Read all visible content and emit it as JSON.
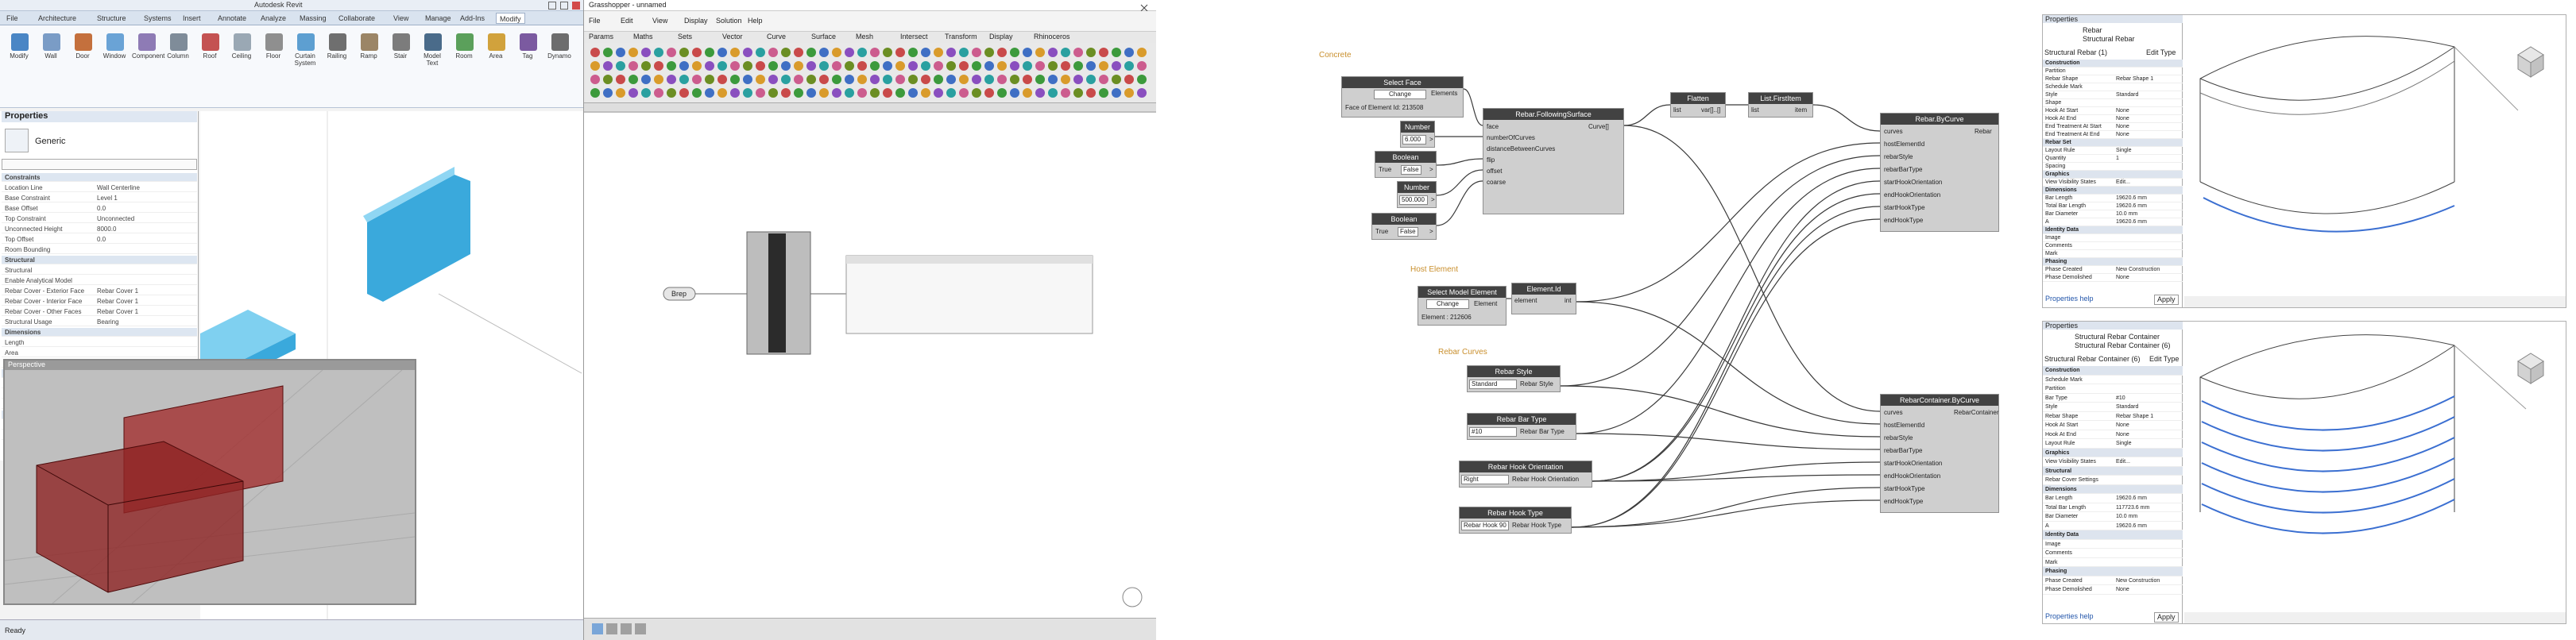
{
  "revit": {
    "title": "Autodesk Revit",
    "tabs": [
      "File",
      "Architecture",
      "Structure",
      "Systems",
      "Insert",
      "Annotate",
      "Analyze",
      "Massing",
      "Collaborate",
      "View",
      "Manage",
      "Add-Ins",
      "Modify"
    ],
    "ribbon_buttons": [
      {
        "label": "Modify",
        "color": "#4a86c5"
      },
      {
        "label": "Wall",
        "color": "#7a9cc6"
      },
      {
        "label": "Door",
        "color": "#c4703d"
      },
      {
        "label": "Window",
        "color": "#6aa3d6"
      },
      {
        "label": "Component",
        "color": "#8e7bb5"
      },
      {
        "label": "Column",
        "color": "#7f8c99"
      },
      {
        "label": "Roof",
        "color": "#c45252"
      },
      {
        "label": "Ceiling",
        "color": "#9aa8b4"
      },
      {
        "label": "Floor",
        "color": "#8f8f8f"
      },
      {
        "label": "Curtain System",
        "color": "#5d9fd1"
      },
      {
        "label": "Railing",
        "color": "#6f6f6f"
      },
      {
        "label": "Ramp",
        "color": "#9b8566"
      },
      {
        "label": "Stair",
        "color": "#7c7c7c"
      },
      {
        "label": "Model Text",
        "color": "#4a6b8a"
      },
      {
        "label": "Room",
        "color": "#5ba05b"
      },
      {
        "label": "Area",
        "color": "#d1a23c"
      },
      {
        "label": "Tag",
        "color": "#7b5aa0"
      },
      {
        "label": "Dynamo",
        "color": "#6d6d6d"
      }
    ],
    "properties_title": "Properties",
    "type_name": "Generic",
    "prop_rows": [
      {
        "k": "Constraints",
        "v": "",
        "head": true
      },
      {
        "k": "Location Line",
        "v": "Wall Centerline"
      },
      {
        "k": "Base Constraint",
        "v": "Level 1"
      },
      {
        "k": "Base Offset",
        "v": "0.0"
      },
      {
        "k": "Top Constraint",
        "v": "Unconnected"
      },
      {
        "k": "Unconnected Height",
        "v": "8000.0"
      },
      {
        "k": "Top Offset",
        "v": "0.0"
      },
      {
        "k": "Room Bounding",
        "v": ""
      },
      {
        "k": "Structural",
        "v": "",
        "head": true
      },
      {
        "k": "Structural",
        "v": ""
      },
      {
        "k": "Enable Analytical Model",
        "v": ""
      },
      {
        "k": "Rebar Cover - Exterior Face",
        "v": "Rebar Cover 1"
      },
      {
        "k": "Rebar Cover - Interior Face",
        "v": "Rebar Cover 1"
      },
      {
        "k": "Rebar Cover - Other Faces",
        "v": "Rebar Cover 1"
      },
      {
        "k": "Structural Usage",
        "v": "Bearing"
      },
      {
        "k": "Dimensions",
        "v": "",
        "head": true
      },
      {
        "k": "Length",
        "v": ""
      },
      {
        "k": "Area",
        "v": ""
      },
      {
        "k": "Volume",
        "v": ""
      },
      {
        "k": "Identity Data",
        "v": "",
        "head": true
      },
      {
        "k": "Image",
        "v": ""
      },
      {
        "k": "Comments",
        "v": ""
      },
      {
        "k": "Mark",
        "v": ""
      },
      {
        "k": "Phasing",
        "v": "",
        "head": true
      },
      {
        "k": "Phase Created",
        "v": "New Construction"
      },
      {
        "k": "Phase Demolished",
        "v": "None"
      }
    ],
    "status_text": "Ready"
  },
  "grasshopper": {
    "title": "Grasshopper - unnamed",
    "menu": [
      "File",
      "Edit",
      "View",
      "Display",
      "Solution",
      "Help"
    ],
    "tabs": [
      "Params",
      "Maths",
      "Sets",
      "Vector",
      "Curve",
      "Surface",
      "Mesh",
      "Intersect",
      "Transform",
      "Display",
      "Rhinoceros"
    ],
    "button_node_label": "Brep",
    "toggle_labels": [
      "B",
      "S",
      "E"
    ],
    "panel_label": "",
    "status_text": "",
    "tool_colors": [
      "#c94a4a",
      "#3c9a3c",
      "#3f6fc4",
      "#d99b2b",
      "#8a4fbf",
      "#2aa0a0",
      "#cc5c8e",
      "#6b8e23"
    ]
  },
  "dynamo": {
    "groups": [
      "Concrete",
      "Host Element",
      "Rebar Curves"
    ],
    "nodes": {
      "select_face": {
        "title": "Select Face",
        "button": "Change",
        "info": "Face of Element Id: 213508",
        "out": "Elements"
      },
      "number1": {
        "title": "Number",
        "value": "6.000",
        "out": ">"
      },
      "boolean1": {
        "title": "Boolean",
        "t": "True",
        "f": "False",
        "out": ">"
      },
      "number2": {
        "title": "Number",
        "value": "500.000",
        "out": ">"
      },
      "boolean2": {
        "title": "Boolean",
        "t": "True",
        "f": "False",
        "out": ">"
      },
      "rebar_follow": {
        "title": "Rebar.FollowingSurface",
        "inputs": [
          "face",
          "numberOfCurves",
          "distanceBetweenCurves",
          "flip",
          "offset",
          "coarse"
        ],
        "out": "Curve[]"
      },
      "flatten": {
        "title": "Flatten",
        "in": "list",
        "out": "var[]..[]"
      },
      "list_first": {
        "title": "List.FirstItem",
        "in": "list",
        "out": "item"
      },
      "rebar_by_curve": {
        "title": "Rebar.ByCurve",
        "inputs": [
          "curves",
          "hostElementId",
          "rebarStyle",
          "rebarBarType",
          "startHookOrientation",
          "endHookOrientation",
          "startHookType",
          "endHookType"
        ],
        "out": "Rebar"
      },
      "select_model": {
        "title": "Select Model Element",
        "button": "Change",
        "info": "Element : 212606",
        "out": "Element"
      },
      "element_id": {
        "title": "Element.Id",
        "in": "element",
        "out": "int"
      },
      "rebar_style": {
        "title": "Rebar Style",
        "value": "Standard",
        "out": "Rebar Style"
      },
      "rebar_bar_type": {
        "title": "Rebar Bar Type",
        "value": "#10",
        "out": "Rebar Bar Type"
      },
      "hook_orient": {
        "title": "Rebar Hook Orientation",
        "value": "Right",
        "out": "Rebar Hook Orientation"
      },
      "hook_type": {
        "title": "Rebar Hook Type",
        "value": "Rebar Hook 90",
        "out": "Rebar Hook Type"
      },
      "container": {
        "title": "RebarContainer.ByCurve",
        "inputs": [
          "curves",
          "hostElementId",
          "rebarStyle",
          "rebarBarType",
          "startHookOrientation",
          "endHookOrientation",
          "startHookType",
          "endHookType"
        ],
        "out": "RebarContainer"
      }
    }
  },
  "revit_result_top": {
    "title": "Properties",
    "type": "Rebar",
    "type_sub": "Structural Rebar",
    "instance": "Structural Rebar (1)",
    "edit_type": "Edit Type",
    "rows": [
      {
        "k": "Construction",
        "v": "",
        "head": true
      },
      {
        "k": "Partition",
        "v": ""
      },
      {
        "k": "Rebar Shape",
        "v": "Rebar Shape 1"
      },
      {
        "k": "Schedule Mark",
        "v": ""
      },
      {
        "k": "Style",
        "v": "Standard"
      },
      {
        "k": "Shape",
        "v": ""
      },
      {
        "k": "Hook At Start",
        "v": "None"
      },
      {
        "k": "Hook At End",
        "v": "None"
      },
      {
        "k": "End Treatment At Start",
        "v": "None"
      },
      {
        "k": "End Treatment At End",
        "v": "None"
      },
      {
        "k": "Rebar Set",
        "v": "",
        "head": true
      },
      {
        "k": "Layout Rule",
        "v": "Single"
      },
      {
        "k": "Quantity",
        "v": "1"
      },
      {
        "k": "Spacing",
        "v": ""
      },
      {
        "k": "Graphics",
        "v": "",
        "head": true
      },
      {
        "k": "View Visibility States",
        "v": "Edit..."
      },
      {
        "k": "Dimensions",
        "v": "",
        "head": true
      },
      {
        "k": "Bar Length",
        "v": "19620.6 mm"
      },
      {
        "k": "Total Bar Length",
        "v": "19620.6 mm"
      },
      {
        "k": "Bar Diameter",
        "v": "10.0 mm"
      },
      {
        "k": "A",
        "v": "19620.6 mm"
      },
      {
        "k": "Identity Data",
        "v": "",
        "head": true
      },
      {
        "k": "Image",
        "v": ""
      },
      {
        "k": "Comments",
        "v": ""
      },
      {
        "k": "Mark",
        "v": ""
      },
      {
        "k": "Phasing",
        "v": "",
        "head": true
      },
      {
        "k": "Phase Created",
        "v": "New Construction"
      },
      {
        "k": "Phase Demolished",
        "v": "None"
      }
    ],
    "help_link": "Properties help",
    "apply": "Apply"
  },
  "revit_result_bottom": {
    "title": "Properties",
    "type": "Structural Rebar Container",
    "type_sub": "Structural Rebar Container (6)",
    "instance": "Structural Rebar Container (6)",
    "edit_type": "Edit Type",
    "rows": [
      {
        "k": "Construction",
        "v": "",
        "head": true
      },
      {
        "k": "Schedule Mark",
        "v": ""
      },
      {
        "k": "Partition",
        "v": ""
      },
      {
        "k": "Bar Type",
        "v": "#10"
      },
      {
        "k": "Style",
        "v": "Standard"
      },
      {
        "k": "Rebar Shape",
        "v": "Rebar Shape 1"
      },
      {
        "k": "Hook At Start",
        "v": "None"
      },
      {
        "k": "Hook At End",
        "v": "None"
      },
      {
        "k": "Layout Rule",
        "v": "Single"
      },
      {
        "k": "Graphics",
        "v": "",
        "head": true
      },
      {
        "k": "View Visibility States",
        "v": "Edit..."
      },
      {
        "k": "Structural",
        "v": "",
        "head": true
      },
      {
        "k": "Rebar Cover Settings",
        "v": ""
      },
      {
        "k": "Dimensions",
        "v": "",
        "head": true
      },
      {
        "k": "Bar Length",
        "v": "19620.6 mm"
      },
      {
        "k": "Total Bar Length",
        "v": "117723.6 mm"
      },
      {
        "k": "Bar Diameter",
        "v": "10.0 mm"
      },
      {
        "k": "A",
        "v": "19620.6 mm"
      },
      {
        "k": "Identity Data",
        "v": "",
        "head": true
      },
      {
        "k": "Image",
        "v": ""
      },
      {
        "k": "Comments",
        "v": ""
      },
      {
        "k": "Mark",
        "v": ""
      },
      {
        "k": "Phasing",
        "v": "",
        "head": true
      },
      {
        "k": "Phase Created",
        "v": "New Construction"
      },
      {
        "k": "Phase Demolished",
        "v": "None"
      }
    ],
    "help_link": "Properties help",
    "apply": "Apply"
  },
  "colors": {
    "node_header": "#424242",
    "node_body": "#cfcfcf",
    "wire": "#3a3a3a",
    "group_label": "#c98f2d",
    "arrow": "#4a6fa5",
    "rebar_line": "#3b6fd1",
    "revit_wall": "#48b6e3",
    "rhino_box": "#9e2a2a"
  }
}
